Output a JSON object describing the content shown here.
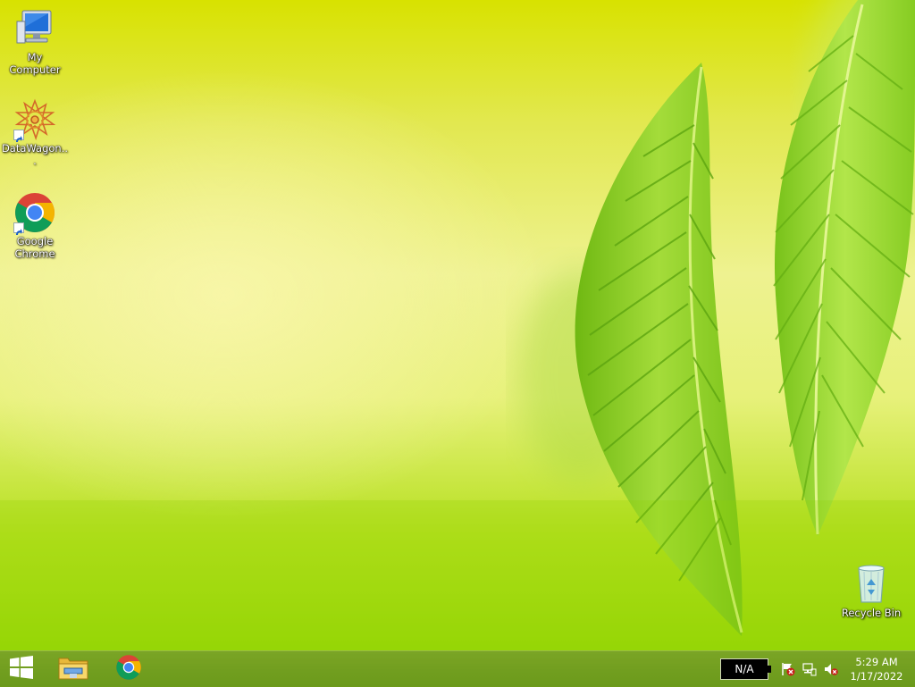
{
  "desktop": {
    "icons": [
      {
        "label": "My Computer",
        "icon": "my-computer-icon"
      },
      {
        "label": "DataWagon...",
        "icon": "datawagon-icon"
      },
      {
        "label": "Google Chrome",
        "icon": "chrome-icon"
      },
      {
        "label": "Recycle Bin",
        "icon": "recycle-bin-icon"
      }
    ]
  },
  "taskbar": {
    "pinned": [
      {
        "icon": "windows-start-icon"
      },
      {
        "icon": "file-explorer-icon"
      },
      {
        "icon": "chrome-icon"
      }
    ],
    "language": "N/A",
    "tray_icons": [
      "action-center-flag-icon",
      "network-icon",
      "volume-muted-icon"
    ],
    "time": "5:29 AM",
    "date": "1/17/2022"
  },
  "colors": {
    "wallpaper_top": "#d8e200",
    "wallpaper_bottom": "#8fd400",
    "leaf": "#7cc31a",
    "taskbar": "#6e9a22"
  }
}
